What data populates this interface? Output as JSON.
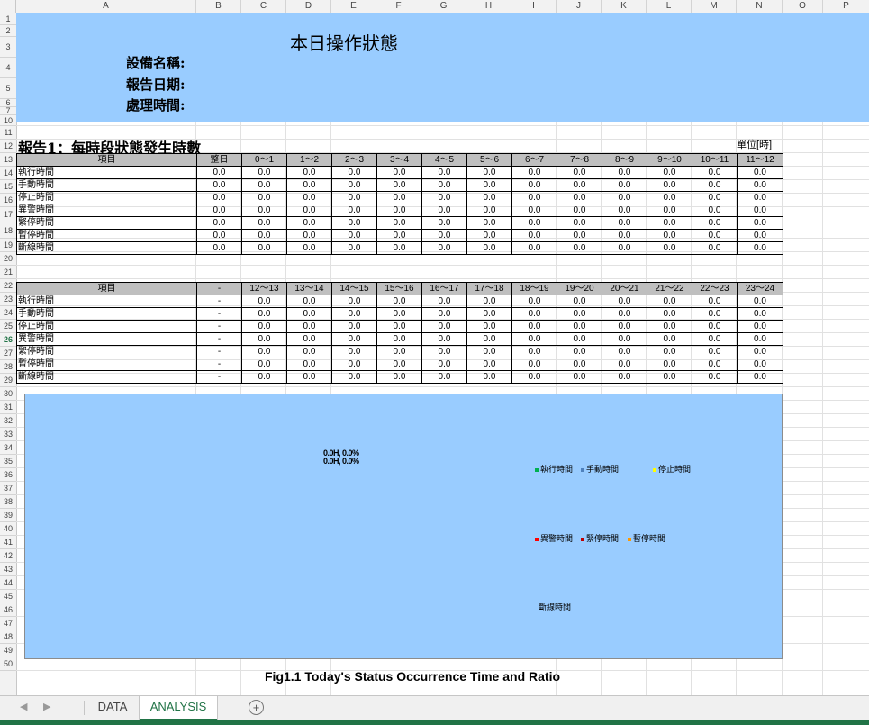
{
  "columns": [
    "A",
    "B",
    "C",
    "D",
    "E",
    "F",
    "G",
    "H",
    "I",
    "J",
    "K",
    "L",
    "M",
    "N",
    "O",
    "P"
  ],
  "rows": [
    "1",
    "2",
    "3",
    "4",
    "5",
    "6",
    "7",
    "10",
    "11",
    "12",
    "13",
    "14",
    "15",
    "16",
    "17",
    "18",
    "19",
    "20",
    "21",
    "22",
    "23",
    "24",
    "25",
    "26",
    "27",
    "28",
    "29",
    "30",
    "31",
    "32",
    "33",
    "34",
    "35",
    "36",
    "37",
    "38",
    "39",
    "40",
    "41",
    "42",
    "43",
    "44",
    "45",
    "46",
    "47",
    "48",
    "49",
    "50"
  ],
  "active_row": "26",
  "banner": {
    "title": "本日操作狀態",
    "device_label": "設備名稱:",
    "date_label": "報告日期:",
    "time_label": "處理時間:"
  },
  "report_title": "報告1：每時段狀態發生時數",
  "unit": "單位[時]",
  "table1": {
    "header": [
      "項目",
      "整日",
      "0～1",
      "1～2",
      "2～3",
      "3～4",
      "4～5",
      "5～6",
      "6～7",
      "7～8",
      "8～9",
      "9～10",
      "10～11",
      "11～12"
    ],
    "rows": [
      [
        "執行時間",
        "0.0",
        "0.0",
        "0.0",
        "0.0",
        "0.0",
        "0.0",
        "0.0",
        "0.0",
        "0.0",
        "0.0",
        "0.0",
        "0.0",
        "0.0"
      ],
      [
        "手動時間",
        "0.0",
        "0.0",
        "0.0",
        "0.0",
        "0.0",
        "0.0",
        "0.0",
        "0.0",
        "0.0",
        "0.0",
        "0.0",
        "0.0",
        "0.0"
      ],
      [
        "停止時間",
        "0.0",
        "0.0",
        "0.0",
        "0.0",
        "0.0",
        "0.0",
        "0.0",
        "0.0",
        "0.0",
        "0.0",
        "0.0",
        "0.0",
        "0.0"
      ],
      [
        "異警時間",
        "0.0",
        "0.0",
        "0.0",
        "0.0",
        "0.0",
        "0.0",
        "0.0",
        "0.0",
        "0.0",
        "0.0",
        "0.0",
        "0.0",
        "0.0"
      ],
      [
        "緊停時間",
        "0.0",
        "0.0",
        "0.0",
        "0.0",
        "0.0",
        "0.0",
        "0.0",
        "0.0",
        "0.0",
        "0.0",
        "0.0",
        "0.0",
        "0.0"
      ],
      [
        "暫停時間",
        "0.0",
        "0.0",
        "0.0",
        "0.0",
        "0.0",
        "0.0",
        "0.0",
        "0.0",
        "0.0",
        "0.0",
        "0.0",
        "0.0",
        "0.0"
      ],
      [
        "斷線時間",
        "0.0",
        "0.0",
        "0.0",
        "0.0",
        "0.0",
        "0.0",
        "0.0",
        "0.0",
        "0.0",
        "0.0",
        "0.0",
        "0.0",
        "0.0"
      ]
    ]
  },
  "table2": {
    "header": [
      "項目",
      "-",
      "12～13",
      "13～14",
      "14～15",
      "15～16",
      "16～17",
      "17～18",
      "18～19",
      "19～20",
      "20～21",
      "21～22",
      "22～23",
      "23～24"
    ],
    "rows": [
      [
        "執行時間",
        "-",
        "0.0",
        "0.0",
        "0.0",
        "0.0",
        "0.0",
        "0.0",
        "0.0",
        "0.0",
        "0.0",
        "0.0",
        "0.0",
        "0.0"
      ],
      [
        "手動時間",
        "-",
        "0.0",
        "0.0",
        "0.0",
        "0.0",
        "0.0",
        "0.0",
        "0.0",
        "0.0",
        "0.0",
        "0.0",
        "0.0",
        "0.0"
      ],
      [
        "停止時間",
        "-",
        "0.0",
        "0.0",
        "0.0",
        "0.0",
        "0.0",
        "0.0",
        "0.0",
        "0.0",
        "0.0",
        "0.0",
        "0.0",
        "0.0"
      ],
      [
        "異警時間",
        "-",
        "0.0",
        "0.0",
        "0.0",
        "0.0",
        "0.0",
        "0.0",
        "0.0",
        "0.0",
        "0.0",
        "0.0",
        "0.0",
        "0.0"
      ],
      [
        "緊停時間",
        "-",
        "0.0",
        "0.0",
        "0.0",
        "0.0",
        "0.0",
        "0.0",
        "0.0",
        "0.0",
        "0.0",
        "0.0",
        "0.0",
        "0.0"
      ],
      [
        "暫停時間",
        "-",
        "0.0",
        "0.0",
        "0.0",
        "0.0",
        "0.0",
        "0.0",
        "0.0",
        "0.0",
        "0.0",
        "0.0",
        "0.0",
        "0.0"
      ],
      [
        "斷線時間",
        "-",
        "0.0",
        "0.0",
        "0.0",
        "0.0",
        "0.0",
        "0.0",
        "0.0",
        "0.0",
        "0.0",
        "0.0",
        "0.0",
        "0.0"
      ]
    ]
  },
  "chart": {
    "overlapping_labels": [
      "0.0H, 0.0%",
      "0.0H, 0.0%"
    ],
    "legend": [
      {
        "label": "執行時間",
        "color": "#00b050"
      },
      {
        "label": "手動時間",
        "color": "#4f81bd"
      },
      {
        "label": "停止時間",
        "color": "#ffff00"
      },
      {
        "label": "異警時間",
        "color": "#ff0000"
      },
      {
        "label": "緊停時間",
        "color": "#c00000"
      },
      {
        "label": "暫停時間",
        "color": "#ff9900"
      },
      {
        "label": "斷線時間",
        "color": "#808080"
      }
    ]
  },
  "caption": "Fig1.1 Today's Status Occurrence Time and Ratio",
  "sheet_tabs": [
    {
      "label": "DATA",
      "active": false
    },
    {
      "label": "ANALYSIS",
      "active": true
    }
  ],
  "add_sheet_symbol": "+"
}
